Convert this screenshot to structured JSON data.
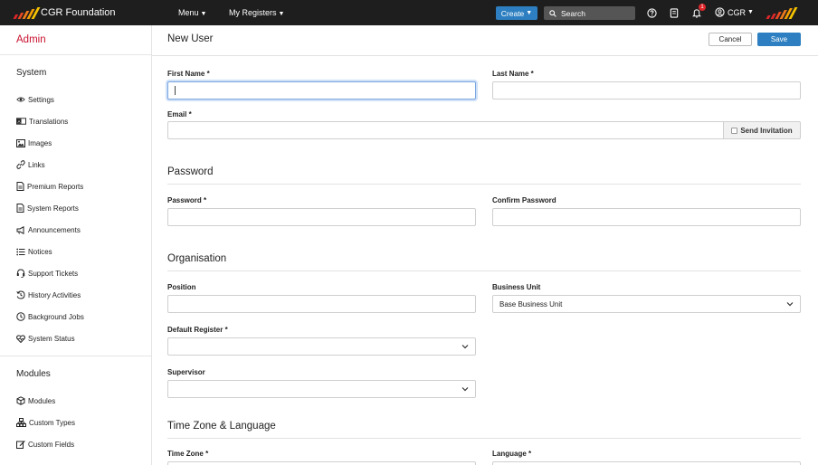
{
  "topbar": {
    "brand": "CGR Foundation",
    "menu_label": "Menu",
    "registers_label": "My Registers",
    "create_label": "Create",
    "search_label": "Search",
    "notification_count": "1",
    "user_label": "CGR",
    "brand_colors": [
      "#e0262a",
      "#f07c1c",
      "#f5b400"
    ]
  },
  "sidebar": {
    "title": "Admin",
    "system_heading": "System",
    "system_items": [
      {
        "label": "Settings",
        "icon": "eye-icon"
      },
      {
        "label": "Translations",
        "icon": "translate-icon"
      },
      {
        "label": "Images",
        "icon": "image-icon"
      },
      {
        "label": "Links",
        "icon": "link-icon"
      },
      {
        "label": "Premium Reports",
        "icon": "report-icon"
      },
      {
        "label": "System Reports",
        "icon": "report-icon"
      },
      {
        "label": "Announcements",
        "icon": "megaphone-icon"
      },
      {
        "label": "Notices",
        "icon": "list-icon"
      },
      {
        "label": "Support Tickets",
        "icon": "headset-icon"
      },
      {
        "label": "History Activities",
        "icon": "history-icon"
      },
      {
        "label": "Background Jobs",
        "icon": "clock-icon"
      },
      {
        "label": "System Status",
        "icon": "heartbeat-icon"
      }
    ],
    "modules_heading": "Modules",
    "module_items": [
      {
        "label": "Modules",
        "icon": "cube-icon"
      },
      {
        "label": "Custom Types",
        "icon": "sitemap-icon"
      },
      {
        "label": "Custom Fields",
        "icon": "edit-icon"
      }
    ]
  },
  "main": {
    "title": "New User",
    "cancel_label": "Cancel",
    "save_label": "Save",
    "first_name_label": "First Name *",
    "first_name_value": "",
    "last_name_label": "Last Name *",
    "last_name_value": "",
    "email_label": "Email *",
    "email_value": "",
    "send_invitation_label": "Send Invitation",
    "send_invitation_checked": false,
    "password_section": "Password",
    "password_label": "Password *",
    "confirm_password_label": "Confirm Password",
    "organisation_section": "Organisation",
    "position_label": "Position",
    "business_unit_label": "Business Unit",
    "business_unit_value": "Base Business Unit",
    "default_register_label": "Default Register *",
    "default_register_value": "",
    "supervisor_label": "Supervisor",
    "supervisor_value": "",
    "timezone_section": "Time Zone & Language",
    "timezone_label": "Time Zone *",
    "language_label": "Language *"
  },
  "colors": {
    "accent": "#2d7fc1",
    "admin_red": "#c8102e",
    "topbar": "#1e1e1e"
  }
}
